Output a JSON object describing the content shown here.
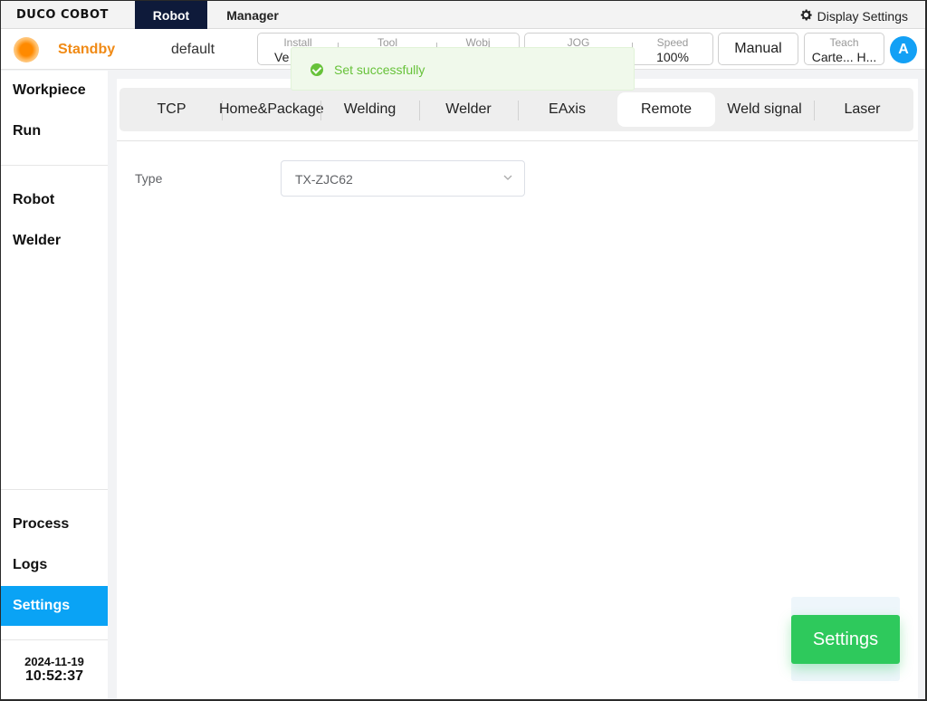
{
  "brand": {
    "logo_text": "DUCO COBOT"
  },
  "top_tabs": {
    "robot": "Robot",
    "manager": "Manager"
  },
  "display_settings": {
    "label": "Display Settings",
    "icon": "gear-icon"
  },
  "status": {
    "state": "Standby",
    "project": "default",
    "install": {
      "label": "Install",
      "value": "Ve"
    },
    "tool": {
      "label": "Tool",
      "value": ""
    },
    "wobj": {
      "label": "Wobj",
      "value": ""
    },
    "jog": {
      "label": "JOG",
      "value": ""
    },
    "speed": {
      "label": "Speed",
      "value": "100%"
    },
    "mode_button": "Manual",
    "teach": {
      "label": "Teach",
      "value": "Carte... H..."
    },
    "avatar": "A"
  },
  "toast": {
    "message": "Set successfully",
    "icon": "check-circle-icon"
  },
  "sidebar": {
    "items": [
      {
        "label": "Workpiece"
      },
      {
        "label": "Run"
      },
      {
        "label": "Robot"
      },
      {
        "label": "Welder"
      },
      {
        "label": "Process"
      },
      {
        "label": "Logs"
      },
      {
        "label": "Settings",
        "active": true
      }
    ],
    "date": "2024-11-19",
    "time": "10:52:37"
  },
  "settings_tabs": [
    {
      "label": "TCP"
    },
    {
      "label": "Home&Package"
    },
    {
      "label": "Welding"
    },
    {
      "label": "Welder"
    },
    {
      "label": "EAxis"
    },
    {
      "label": "Remote",
      "active": true
    },
    {
      "label": "Weld signal"
    },
    {
      "label": "Laser"
    }
  ],
  "form": {
    "type_label": "Type",
    "type_value": "TX-ZJC62"
  },
  "footer_button": "Settings",
  "colors": {
    "accent": "#0aa3f5",
    "standby": "#f08a15",
    "success": "#67c23a",
    "primary_button": "#2ec95c",
    "nav_dark": "#0e1a3a"
  }
}
